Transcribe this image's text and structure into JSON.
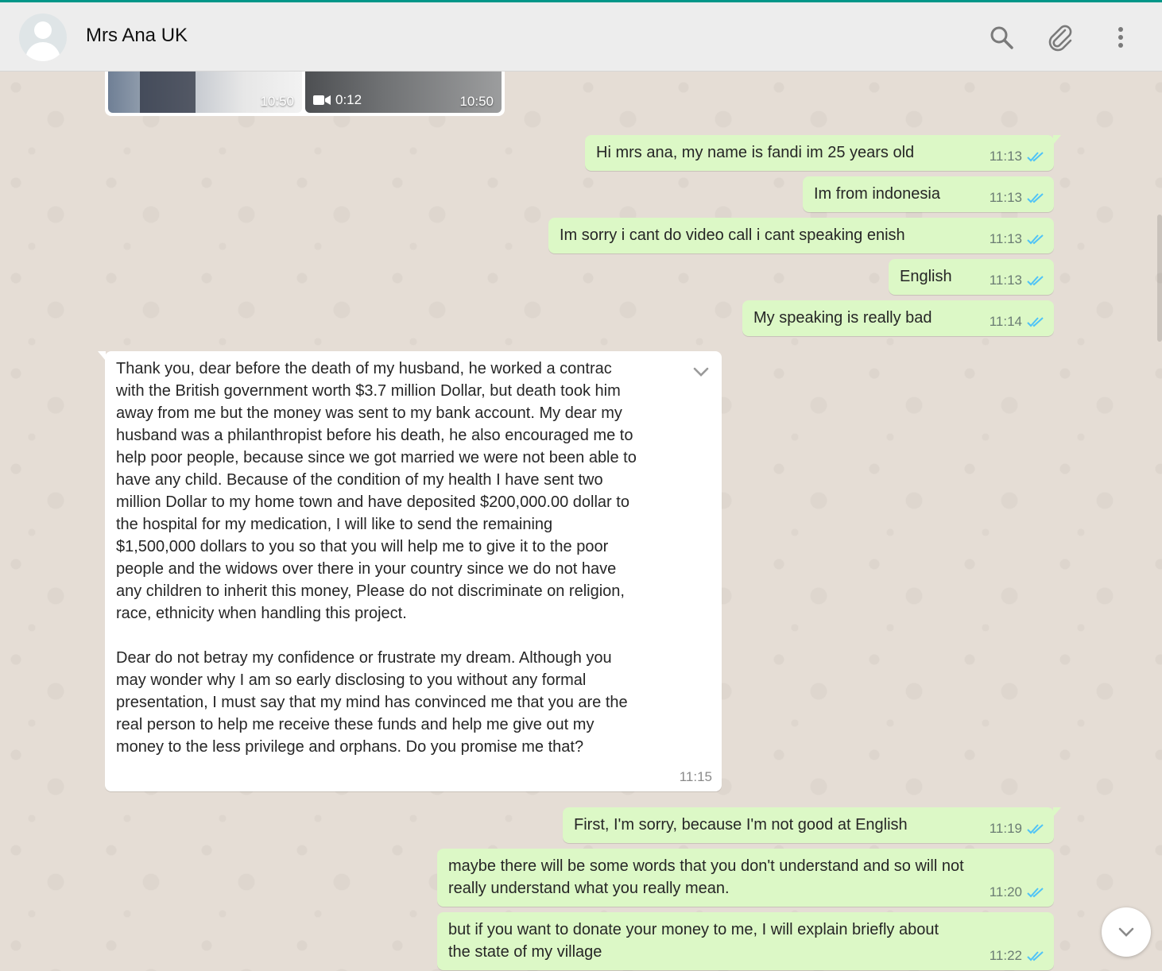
{
  "header": {
    "contact_name": "Mrs Ana UK",
    "icons": [
      "person-icon",
      "search-icon",
      "attach-icon",
      "menu-icon"
    ]
  },
  "media": [
    {
      "time": "10:50"
    },
    {
      "duration": "0:12",
      "time": "10:50"
    }
  ],
  "messages": [
    {
      "dir": "out",
      "text": "Hi mrs ana, my name is fandi im 25 years old",
      "time": "11:13",
      "status": "read"
    },
    {
      "dir": "out",
      "text": "Im from indonesia",
      "time": "11:13",
      "status": "read"
    },
    {
      "dir": "out",
      "text": "Im sorry i cant do video call i cant speaking enish",
      "time": "11:13",
      "status": "read"
    },
    {
      "dir": "out",
      "text": "English",
      "time": "11:13",
      "status": "read"
    },
    {
      "dir": "out",
      "text": "My speaking is really bad",
      "time": "11:14",
      "status": "read"
    },
    {
      "dir": "in",
      "text": "Thank you, dear before the death of my husband, he worked a contrac\nwith the British government worth $3.7 million Dollar, but death took him\naway from me but the money was sent to my bank account. My dear my\nhusband was a philanthropist before his death, he also encouraged me to\nhelp poor people, because since we got married we were not been able to\nhave any child. Because of the condition of my health I have sent two\nmillion Dollar to my home town and have deposited $200,000.00 dollar to\nthe hospital for my medication, I will like to send the remaining\n$1,500,000 dollars to you so that you will help me to give it to the poor\npeople and the widows over there in your country since we do not have\nany children to inherit this money, Please do not discriminate on religion,\nrace, ethnicity when handling this project.\n\nDear do not betray my confidence or frustrate my dream. Although you\nmay wonder why I am so early disclosing to you without any formal\npresentation, I must say that my mind has convinced me that you are the\nreal person to help me receive these funds and help me give out my\nmoney to the less privilege and orphans. Do you promise me that?",
      "time": "11:15"
    },
    {
      "dir": "out",
      "text": "First, I'm sorry, because I'm not good at English",
      "time": "11:19",
      "status": "read"
    },
    {
      "dir": "out",
      "text": "maybe there will be some words that you don't understand and so will not\nreally understand what you really mean.",
      "time": "11:20",
      "status": "read"
    },
    {
      "dir": "out",
      "text": "but if you want to donate your money to me, I will explain briefly about\nthe state of my village",
      "time": "11:22",
      "status": "read"
    }
  ],
  "colors": {
    "outgoing_bubble": "#dcf8c6",
    "incoming_bubble": "#ffffff",
    "read_ticks": "#4fc3f7",
    "chat_background": "#e5ddd5",
    "header_accent": "#009688"
  }
}
